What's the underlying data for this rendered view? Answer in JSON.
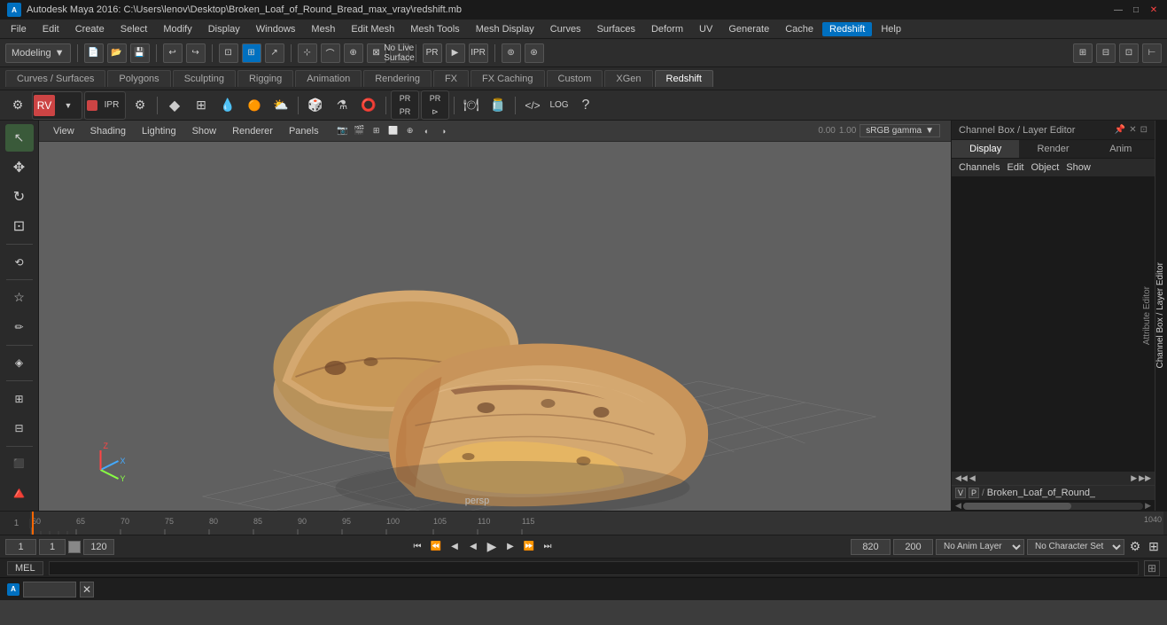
{
  "titlebar": {
    "logo": "A",
    "title": "Autodesk Maya 2016: C:\\Users\\lenov\\Desktop\\Broken_Loaf_of_Round_Bread_max_vray\\redshift.mb",
    "minimize": "—",
    "maximize": "□",
    "close": "✕"
  },
  "menubar": {
    "items": [
      "File",
      "Edit",
      "Create",
      "Select",
      "Modify",
      "Display",
      "Windows",
      "Mesh",
      "Edit Mesh",
      "Mesh Tools",
      "Mesh Display",
      "Curves",
      "Surfaces",
      "Deform",
      "UV",
      "Generate",
      "Cache",
      "Redshift",
      "Help"
    ]
  },
  "workspace": {
    "label": "Modeling",
    "arrow": "▼"
  },
  "tabs": {
    "items": [
      "Curves / Surfaces",
      "Polygons",
      "Sculpting",
      "Rigging",
      "Animation",
      "Rendering",
      "FX",
      "FX Caching",
      "Custom",
      "XGen",
      "Redshift"
    ]
  },
  "viewport": {
    "menus": [
      "View",
      "Shading",
      "Lighting",
      "Show",
      "Renderer",
      "Panels"
    ],
    "label": "persp",
    "perspective_label": "persp"
  },
  "channelbox": {
    "title": "Channel Box / Layer Editor",
    "tabs": [
      "Display",
      "Render",
      "Anim"
    ],
    "menus": [
      "Channels",
      "Edit",
      "Object",
      "Show"
    ],
    "layer_label": "Broken_Loaf_of_Round_",
    "layer_arrows": [
      "◀◀",
      "◀",
      "▶",
      "▶▶"
    ]
  },
  "timeline": {
    "marks": [
      "60",
      "100",
      "105",
      "110",
      "115"
    ],
    "frame_start": "1",
    "frame_current": "1",
    "playback_start": "120",
    "playback_end": "200",
    "anim_layer": "No Anim Layer",
    "char_set": "No Character Set",
    "range_start": "120"
  },
  "statusbar": {
    "mel_label": "MEL",
    "grid_icon": "⊞"
  },
  "left_toolbar": {
    "tools": [
      "↖",
      "⟳",
      "✥",
      "↔",
      "⟳",
      "☰",
      "◈",
      "⊡",
      "⊞",
      "⊟",
      "+"
    ]
  },
  "time_ruler_marks": [
    {
      "val": "60",
      "pos": 1
    },
    {
      "val": "65",
      "pos": 5
    },
    {
      "val": "70",
      "pos": 9
    },
    {
      "val": "75",
      "pos": 13
    },
    {
      "val": "80",
      "pos": 17
    },
    {
      "val": "85",
      "pos": 21
    },
    {
      "val": "90",
      "pos": 25
    },
    {
      "val": "95",
      "pos": 29
    },
    {
      "val": "100",
      "pos": 33
    },
    {
      "val": "105",
      "pos": 37
    },
    {
      "val": "110",
      "pos": 41
    },
    {
      "val": "115",
      "pos": 46
    },
    {
      "val": "1040",
      "pos": 97
    }
  ],
  "colors": {
    "accent_blue": "#0070c0",
    "bg_dark": "#1a1a1a",
    "bg_medium": "#2d2d2d",
    "bg_light": "#3c3c3c",
    "text_light": "#cccccc",
    "separator": "#555555",
    "active_tab": "#3c3c3c",
    "orange_indicator": "#ff6600"
  }
}
